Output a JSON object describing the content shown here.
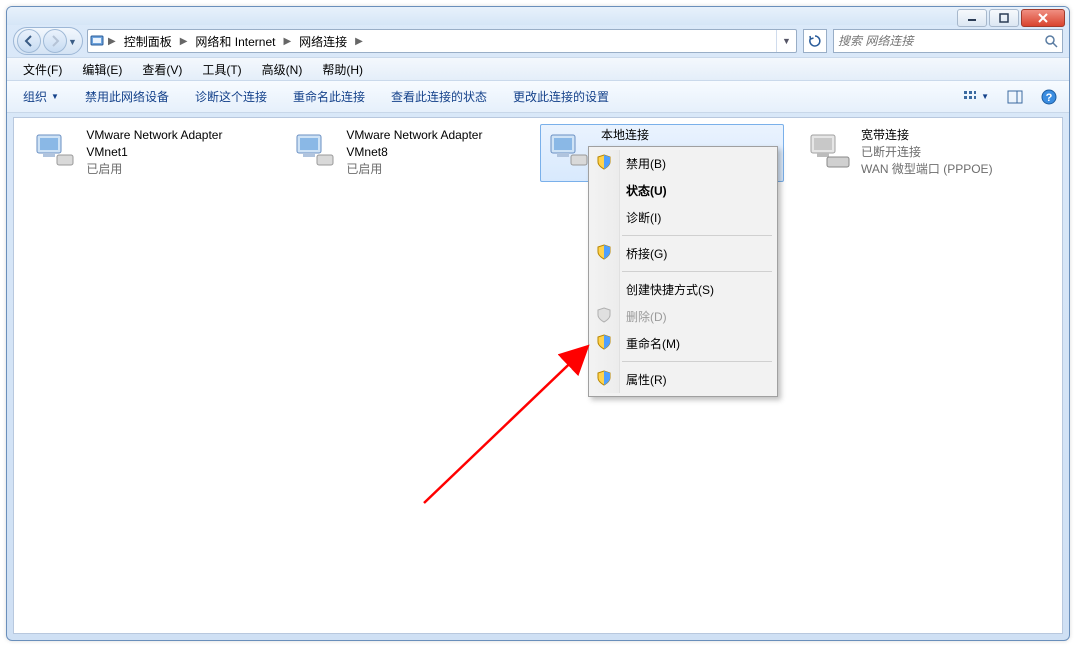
{
  "breadcrumb": {
    "seg1": "控制面板",
    "seg2": "网络和 Internet",
    "seg3": "网络连接"
  },
  "search": {
    "placeholder": "搜索 网络连接"
  },
  "menubar": {
    "file": "文件(F)",
    "edit": "编辑(E)",
    "view": "查看(V)",
    "tools": "工具(T)",
    "advanced": "高级(N)",
    "help": "帮助(H)"
  },
  "cmdbar": {
    "organize": "组织",
    "disable": "禁用此网络设备",
    "diagnose": "诊断这个连接",
    "rename": "重命名此连接",
    "status": "查看此连接的状态",
    "settings": "更改此连接的设置"
  },
  "items": {
    "vmnet1": {
      "title": "VMware Network Adapter VMnet1",
      "line2": "已启用"
    },
    "vmnet8": {
      "title": "VMware Network Adapter VMnet8",
      "line2": "已启用"
    },
    "local": {
      "title": "本地连接"
    },
    "broadband": {
      "title": "宽带连接",
      "line2": "已断开连接",
      "line3": "WAN 微型端口 (PPPOE)"
    }
  },
  "ctx": {
    "disable": "禁用(B)",
    "status": "状态(U)",
    "diagnose": "诊断(I)",
    "bridge": "桥接(G)",
    "shortcut": "创建快捷方式(S)",
    "delete": "删除(D)",
    "rename": "重命名(M)",
    "props": "属性(R)"
  }
}
